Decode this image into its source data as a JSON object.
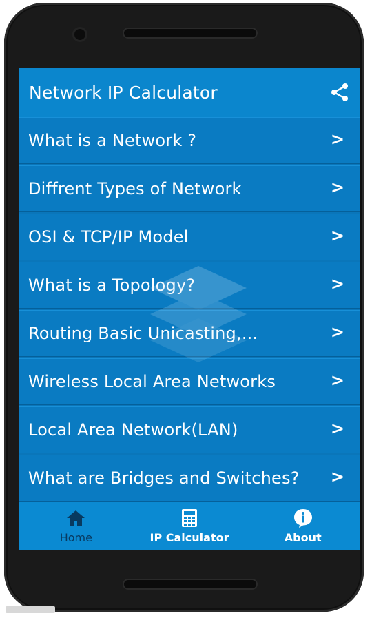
{
  "app": {
    "title": "Network IP Calculator",
    "share_icon": "share-icon"
  },
  "menu": {
    "items": [
      {
        "label": "What is a Network ?"
      },
      {
        "label": "Diffrent Types of Network"
      },
      {
        "label": "OSI & TCP/IP Model"
      },
      {
        "label": "What is a Topology?"
      },
      {
        "label": "Routing Basic Unicasting,..."
      },
      {
        "label": "Wireless Local Area Networks"
      },
      {
        "label": "Local Area Network(LAN)"
      },
      {
        "label": "What are Bridges and Switches?"
      }
    ],
    "chevron": ">"
  },
  "bottom_nav": {
    "home": {
      "label": "Home",
      "icon": "home-icon"
    },
    "ip_calculator": {
      "label": "IP Calculator",
      "icon": "calculator-icon"
    },
    "about": {
      "label": "About",
      "icon": "info-icon"
    }
  },
  "colors": {
    "primary": "#0b86cd",
    "list_bg": "#0a7bc2",
    "inactive_text": "#083a60"
  }
}
